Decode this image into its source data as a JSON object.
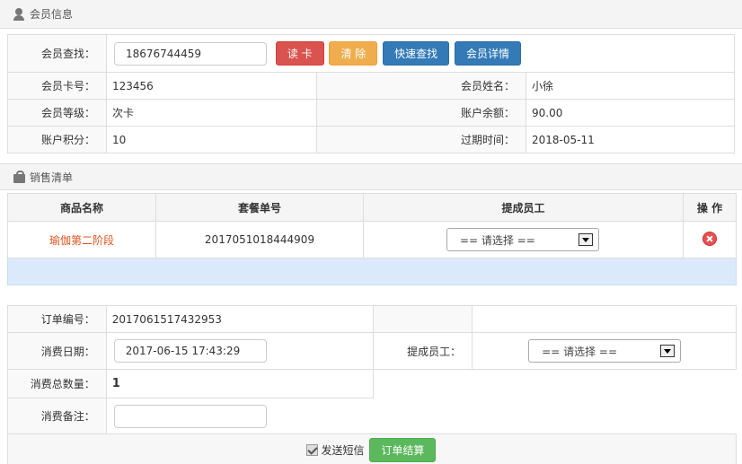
{
  "member_section": {
    "title": "会员信息",
    "icon": "user-icon"
  },
  "member_search": {
    "label": "会员查找：",
    "value": "18676744459",
    "buttons": {
      "read_card": "读 卡",
      "clear": "清 除",
      "quick_find": "快速查找",
      "details": "会员详情"
    }
  },
  "member": {
    "card_no_label": "会员卡号：",
    "card_no": "123456",
    "name_label": "会员姓名：",
    "name": "小徐",
    "level_label": "会员等级：",
    "level": "次卡",
    "balance_label": "账户余额：",
    "balance": "90.00",
    "points_label": "账户积分：",
    "points": "10",
    "expiry_label": "过期时间：",
    "expiry": "2018-05-11"
  },
  "sales_section": {
    "title": "销售清单",
    "icon": "bag-icon"
  },
  "sales_table": {
    "headers": [
      "商品名称",
      "套餐单号",
      "提成员工",
      "操 作"
    ],
    "rows": [
      {
        "product": "瑜伽第二阶段",
        "package_no": "2017051018444909",
        "employee": "== 请选择 =="
      }
    ]
  },
  "order": {
    "no_label": "订单编号：",
    "no": "2017061517432953",
    "date_label": "消费日期：",
    "date": "2017-06-15 17:43:29",
    "employee_label": "提成员工：",
    "employee": "== 请选择 ==",
    "qty_label": "消费总数量：",
    "qty": "1",
    "note_label": "消费备注：",
    "note": "",
    "sms_label": "发送短信",
    "checkout": "订单结算"
  },
  "colors": {
    "product_link": "#e0531f",
    "highlight_row": "#dbeafb"
  }
}
